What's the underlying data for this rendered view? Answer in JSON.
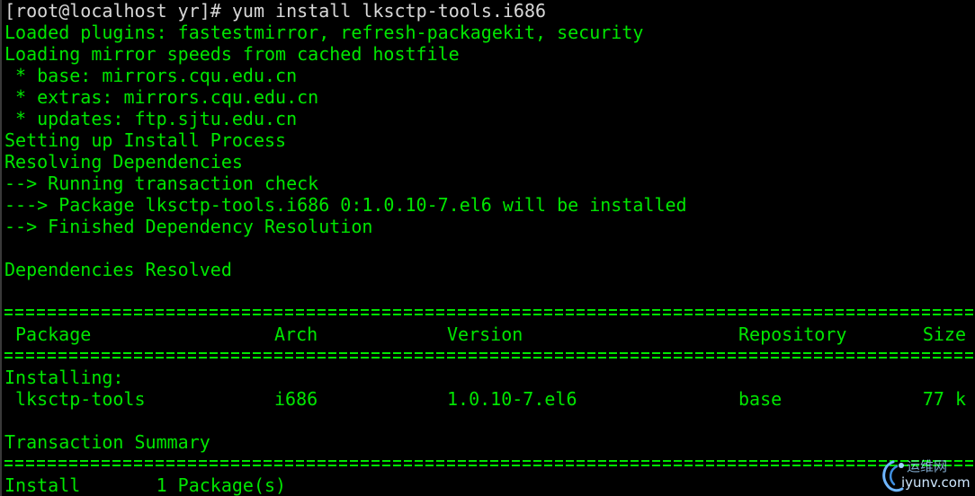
{
  "terminal": {
    "prompt": "[root@localhost yr]#",
    "command": " yum install lksctp-tools.i686",
    "output_top": [
      "Loaded plugins: fastestmirror, refresh-packagekit, security",
      "Loading mirror speeds from cached hostfile",
      " * base: mirrors.cqu.edu.cn",
      " * extras: mirrors.cqu.edu.cn",
      " * updates: ftp.sjtu.edu.cn",
      "Setting up Install Process",
      "Resolving Dependencies",
      "--> Running transaction check",
      "---> Package lksctp-tools.i686 0:1.0.10-7.el6 will be installed",
      "--> Finished Dependency Resolution",
      "",
      "Dependencies Resolved"
    ],
    "table": {
      "headers": {
        "package": "Package",
        "arch": "Arch",
        "version": "Version",
        "repository": "Repository",
        "size": "Size"
      },
      "section_label": "Installing:",
      "row": {
        "package": "lksctp-tools",
        "arch": "i686",
        "version": "1.0.10-7.el6",
        "repository": "base",
        "size": "77 k"
      }
    },
    "summary_title": "Transaction Summary",
    "install_line": "Install       1 Package(s)"
  },
  "watermark": {
    "site_cn": "运维网",
    "url": "iyunv.com"
  },
  "colors": {
    "background": "#000000",
    "text": "#00e600",
    "prompt": "#d8d8d8"
  }
}
